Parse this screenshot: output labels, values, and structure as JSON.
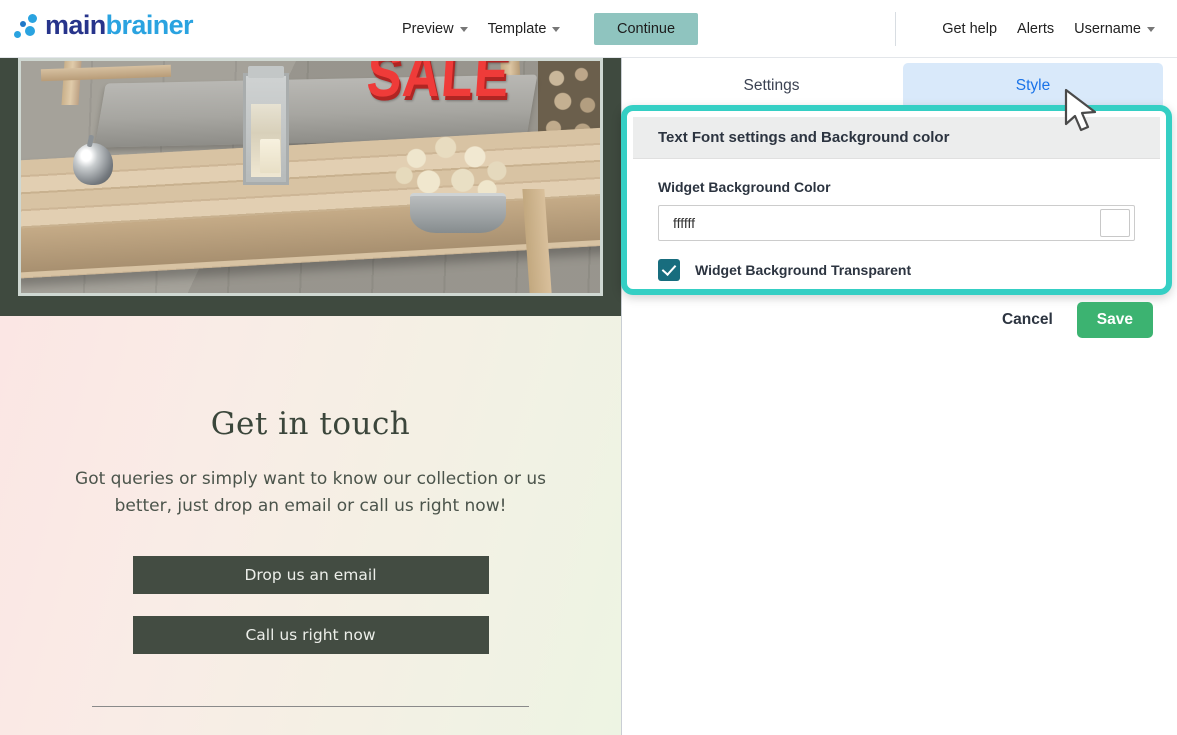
{
  "header": {
    "logo": {
      "part1": "main",
      "part2": "brainer",
      "icon": "logo-dots-icon"
    },
    "nav": [
      {
        "label": "Preview",
        "has_caret": true
      },
      {
        "label": "Template",
        "has_caret": true
      }
    ],
    "continue_label": "Continue",
    "right_nav": [
      {
        "label": "Get help",
        "has_caret": false
      },
      {
        "label": "Alerts",
        "has_caret": false
      },
      {
        "label": "Username",
        "has_caret": true
      }
    ]
  },
  "preview": {
    "hero": {
      "sale_text": "SALE",
      "alt": "outdoor patio bench with lantern, flowers and SALE sign"
    },
    "heading": "Get in touch",
    "paragraph": "Got queries or simply want to know our collection or us better, just drop an email or call us right now!",
    "buttons": [
      {
        "label": "Drop us an email"
      },
      {
        "label": "Call us right now"
      }
    ]
  },
  "panel": {
    "tabs": [
      {
        "label": "Settings",
        "active": false
      },
      {
        "label": "Style",
        "active": true
      }
    ],
    "section_title": "Text Font settings and Background color",
    "field_label": "Widget Background Color",
    "color_value": "ffffff",
    "color_placeholder": "ffffff",
    "swatch_color": "#ffffff",
    "checkbox": {
      "label": "Widget Background Transparent",
      "checked": true
    },
    "cancel_label": "Cancel",
    "save_label": "Save"
  },
  "colors": {
    "highlight_teal": "#35cfc4",
    "save_green": "#3cb371",
    "continue_teal": "#8fc4bf",
    "tab_active_bg": "#d9e9fa",
    "tab_active_text": "#1a73e8",
    "checkbox_teal": "#186d7e",
    "cta_dark": "#434c42",
    "sale_red": "#ef3b39",
    "logo_navy": "#27348b",
    "logo_blue": "#2aa3e0"
  }
}
